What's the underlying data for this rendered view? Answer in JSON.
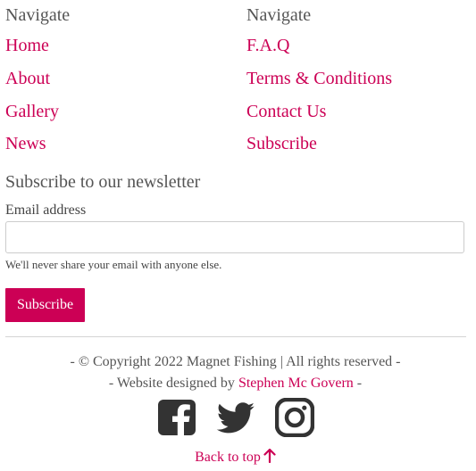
{
  "nav_left": {
    "heading": "Navigate",
    "links": [
      "Home",
      "About",
      "Gallery",
      "News"
    ]
  },
  "nav_right": {
    "heading": "Navigate",
    "links": [
      "F.A.Q",
      "Terms & Conditions",
      "Contact Us",
      "Subscribe"
    ]
  },
  "newsletter": {
    "title": "Subscribe to our newsletter",
    "email_label": "Email address",
    "email_value": "",
    "help_text": "We'll never share your email with anyone else.",
    "button_label": "Subscribe"
  },
  "footer": {
    "copyright": "- © Copyright 2022 Magnet Fishing | All rights reserved -",
    "designed_prefix": "- Website designed by ",
    "designer_name": "Stephen Mc Govern",
    "designed_suffix": " -",
    "back_to_top": "Back to top"
  },
  "social_icons": [
    "facebook-icon",
    "twitter-icon",
    "instagram-icon"
  ],
  "colors": {
    "accent": "#cc0055",
    "text": "#555555",
    "icon": "#333333"
  }
}
